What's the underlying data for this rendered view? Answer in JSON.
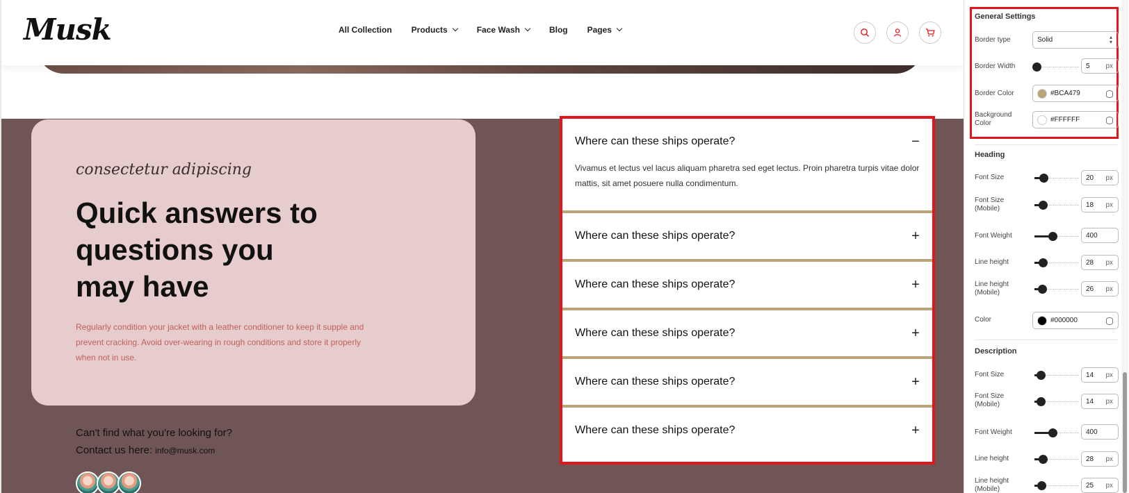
{
  "header": {
    "logo": "Musk",
    "nav": [
      {
        "label": "All Collection",
        "has_dropdown": false
      },
      {
        "label": "Products",
        "has_dropdown": true
      },
      {
        "label": "Face Wash",
        "has_dropdown": true
      },
      {
        "label": "Blog",
        "has_dropdown": false
      },
      {
        "label": "Pages",
        "has_dropdown": true
      }
    ],
    "icons": [
      "search-icon",
      "user-icon",
      "cart-icon"
    ]
  },
  "faq_section": {
    "eyebrow": "consectetur adipiscing",
    "title_lines": [
      "Quick answers to",
      "questions you",
      "may have"
    ],
    "description": "Regularly condition your jacket with a leather conditioner to keep it supple and prevent cracking. Avoid over-wearing in rough conditions and store it properly when not in use.",
    "cant_find": "Can't find what you're looking for?",
    "contact_label": "Contact us here:",
    "contact_email": "info@musk.com",
    "items": [
      {
        "question": "Where can these ships operate?",
        "expanded": true,
        "sign": "−",
        "answer": "Vivamus et lectus vel lacus aliquam pharetra sed eget lectus. Proin pharetra turpis vitae dolor mattis, sit amet posuere nulla condimentum."
      },
      {
        "question": "Where can these ships operate?",
        "expanded": false,
        "sign": "+"
      },
      {
        "question": "Where can these ships operate?",
        "expanded": false,
        "sign": "+"
      },
      {
        "question": "Where can these ships operate?",
        "expanded": false,
        "sign": "+"
      },
      {
        "question": "Where can these ships operate?",
        "expanded": false,
        "sign": "+"
      },
      {
        "question": "Where can these ships operate?",
        "expanded": false,
        "sign": "+"
      }
    ]
  },
  "colors": {
    "section_bg": "#705556",
    "card_bg": "#E7CCCD",
    "border": "#BCA479",
    "highlight": "#E4141C",
    "description_text": "#C0605A"
  },
  "panel": {
    "general": {
      "title": "General Settings",
      "border_type": {
        "label": "Border type",
        "value": "Solid"
      },
      "border_width": {
        "label": "Border Width",
        "value": "5",
        "unit": "px",
        "fraction": 0.05
      },
      "border_color": {
        "label": "Border Color",
        "value": "#BCA479",
        "swatch": "#BCA479"
      },
      "background_color": {
        "label": "Background Color",
        "value": "#FFFFFF",
        "swatch": "#FFFFFF"
      }
    },
    "heading": {
      "title": "Heading",
      "font_size": {
        "label": "Font Size",
        "value": "20",
        "unit": "px",
        "fraction": 0.2
      },
      "font_size_mobile": {
        "label": "Font Size (Mobile)",
        "value": "18",
        "unit": "px",
        "fraction": 0.18
      },
      "font_weight": {
        "label": "Font Weight",
        "value": "400",
        "fraction": 0.4
      },
      "line_height": {
        "label": "Line height",
        "value": "28",
        "unit": "px",
        "fraction": 0.18
      },
      "line_height_mobile": {
        "label": "Line height (Mobile)",
        "value": "26",
        "unit": "px",
        "fraction": 0.17
      },
      "color": {
        "label": "Color",
        "value": "#000000",
        "swatch": "#000000"
      }
    },
    "description": {
      "title": "Description",
      "font_size": {
        "label": "Font Size",
        "value": "14",
        "unit": "px",
        "fraction": 0.14
      },
      "font_size_mobile": {
        "label": "Font Size (Mobile)",
        "value": "14",
        "unit": "px",
        "fraction": 0.14
      },
      "font_weight": {
        "label": "Font Weight",
        "value": "400",
        "fraction": 0.4
      },
      "line_height": {
        "label": "Line height",
        "value": "28",
        "unit": "px",
        "fraction": 0.18
      },
      "line_height_mobile": {
        "label": "Line height (Mobile)",
        "value": "25",
        "unit": "px",
        "fraction": 0.16
      }
    }
  }
}
